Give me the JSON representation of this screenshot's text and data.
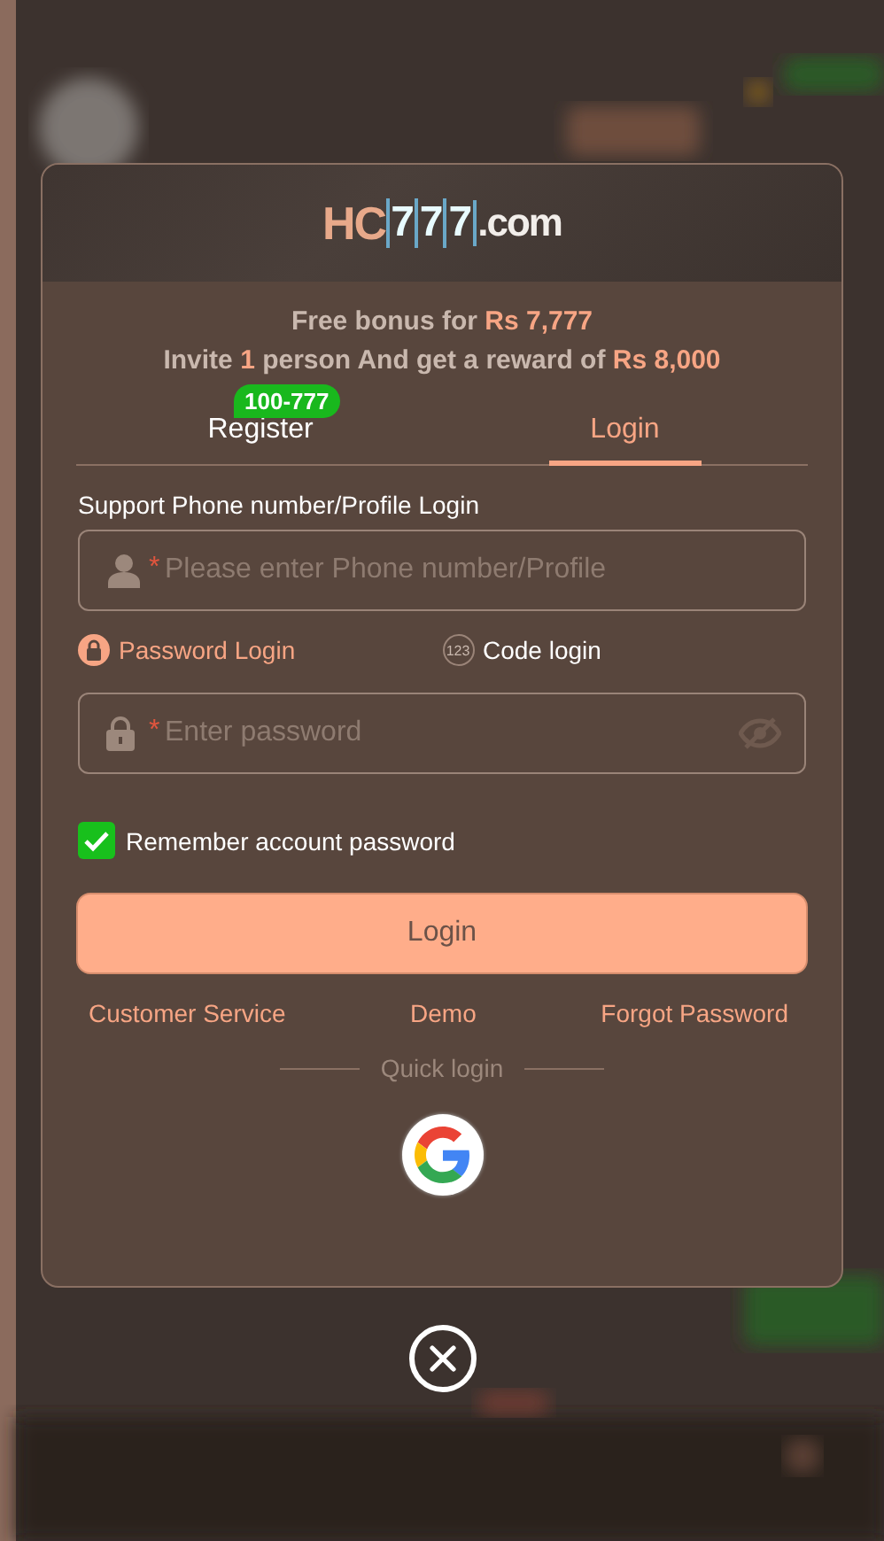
{
  "logo": {
    "prefix": "HC",
    "digits": [
      "7",
      "7",
      "7"
    ],
    "suffix": ".com"
  },
  "promo": [
    "Free bonus for **Rs 7,777**",
    "Invite **1** person And get a reward of **Rs 8,000**"
  ],
  "tabs": [
    {
      "label": "Register",
      "selected": false,
      "badge": "100-777"
    },
    {
      "label": "Login",
      "selected": true
    }
  ],
  "account_label": "Support Phone number/Profile Login",
  "account_field": {
    "placeholder": "Please enter Phone number/Profile",
    "required_mark": "*"
  },
  "login_methods": [
    {
      "label": "Password Login",
      "kind": "lock",
      "selected": true
    },
    {
      "label": "Code login",
      "kind": "code",
      "icon_text": "123",
      "selected": false
    }
  ],
  "password_field": {
    "placeholder": "Enter password",
    "required_mark": "*"
  },
  "remember": {
    "label": "Remember account password",
    "checked": true
  },
  "submit": "Login",
  "links": [
    "Customer Service",
    "Demo",
    "Forgot Password"
  ],
  "quick_login": {
    "label": "Quick login"
  }
}
